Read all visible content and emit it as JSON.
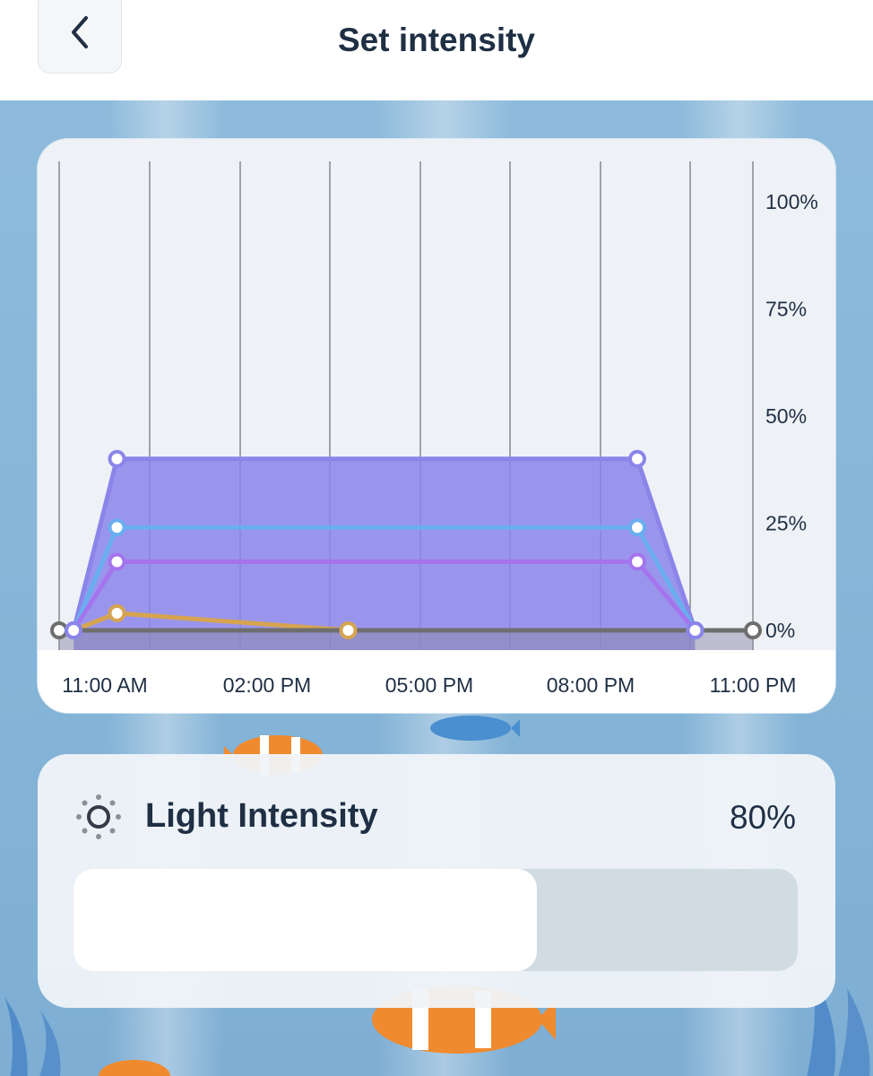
{
  "header": {
    "title": "Set intensity",
    "back_icon": "chevron-left-icon"
  },
  "chart_data": {
    "type": "line",
    "y_tick_labels": [
      "100%",
      "75%",
      "50%",
      "25%",
      "0%"
    ],
    "x_tick_labels": [
      "11:00 AM",
      "02:00 PM",
      "05:00 PM",
      "08:00 PM",
      "11:00 PM"
    ],
    "ylim": [
      0,
      100
    ],
    "grid": true,
    "series": [
      {
        "color": "#8b85ea",
        "fill": true,
        "x": [
          "11:15 AM",
          "12:00 PM",
          "09:00 PM",
          "10:00 PM"
        ],
        "y": [
          0,
          40,
          40,
          0
        ]
      },
      {
        "color": "#69aeee",
        "fill": false,
        "x": [
          "11:15 AM",
          "12:00 PM",
          "09:00 PM",
          "10:00 PM"
        ],
        "y": [
          0,
          24,
          24,
          0
        ]
      },
      {
        "color": "#a474ee",
        "fill": false,
        "x": [
          "11:15 AM",
          "12:00 PM",
          "09:00 PM",
          "10:00 PM"
        ],
        "y": [
          0,
          16,
          16,
          0
        ]
      },
      {
        "color": "#d6a451",
        "fill": false,
        "x": [
          "11:15 AM",
          "12:00 PM",
          "04:00 PM",
          "10:00 PM"
        ],
        "y": [
          0,
          4,
          0,
          0
        ]
      },
      {
        "color": "#6e6e6e",
        "fill": false,
        "x": [
          "11:00 AM",
          "11:00 PM"
        ],
        "y": [
          0,
          0
        ]
      }
    ]
  },
  "intensity": {
    "label": "Light Intensity",
    "value_text": "80%",
    "value": 80,
    "icon": "sun-icon"
  },
  "colors": {
    "title": "#1f2f44",
    "background": "#7eaed3",
    "track": "#d1dbe2",
    "fill": "#ffffff"
  }
}
